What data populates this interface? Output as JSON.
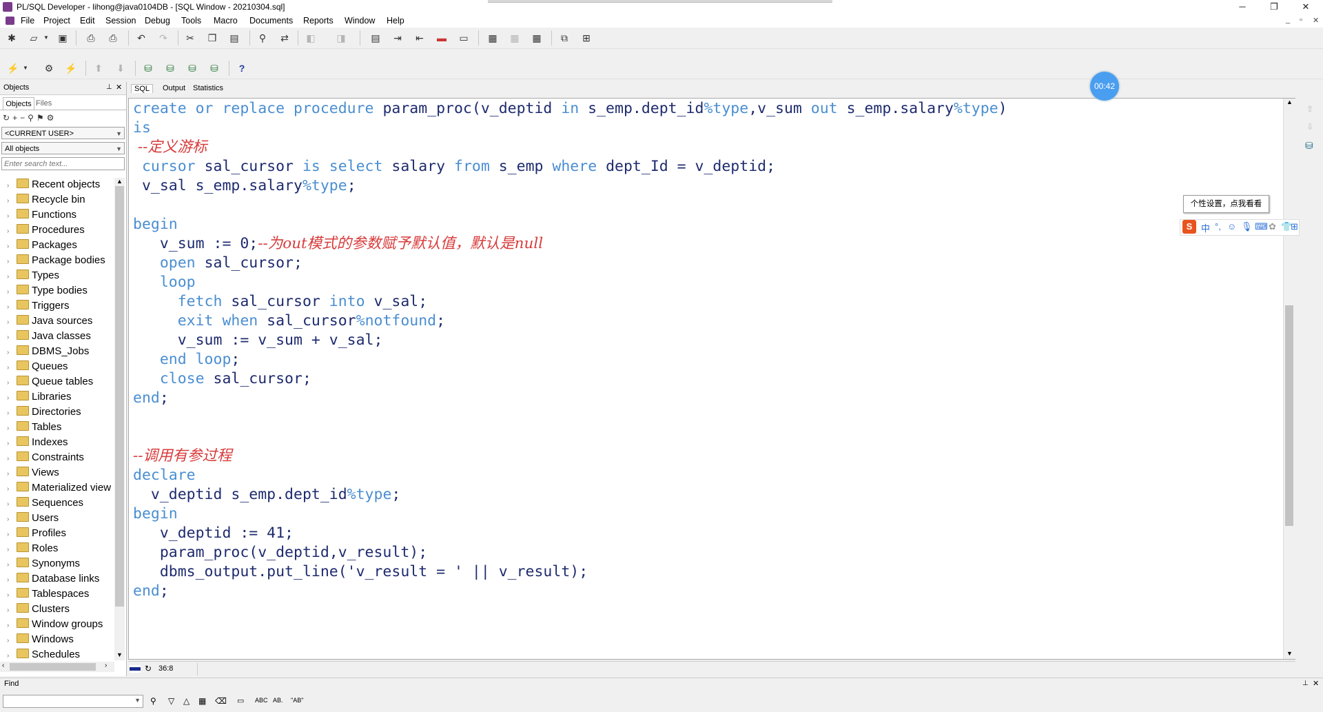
{
  "window": {
    "title": "PL/SQL Developer - lihong@java0104DB - [SQL Window - 20210304.sql]",
    "controls": [
      "─",
      "❐",
      "✕"
    ]
  },
  "menu": [
    "File",
    "Project",
    "Edit",
    "Session",
    "Debug",
    "Tools",
    "Macro",
    "Documents",
    "Reports",
    "Window",
    "Help"
  ],
  "objects_panel": {
    "title": "Objects",
    "tabs": [
      "Objects",
      "Files"
    ],
    "user_combo": "<CURRENT USER>",
    "filter_combo": "All objects",
    "search_placeholder": "Enter search text...",
    "tree": [
      "Recent objects",
      "Recycle bin",
      "Functions",
      "Procedures",
      "Packages",
      "Package bodies",
      "Types",
      "Type bodies",
      "Triggers",
      "Java sources",
      "Java classes",
      "DBMS_Jobs",
      "Queues",
      "Queue tables",
      "Libraries",
      "Directories",
      "Tables",
      "Indexes",
      "Constraints",
      "Views",
      "Materialized view",
      "Sequences",
      "Users",
      "Profiles",
      "Roles",
      "Synonyms",
      "Database links",
      "Tablespaces",
      "Clusters",
      "Window groups",
      "Windows",
      "Schedules"
    ]
  },
  "editor": {
    "tabs": [
      "SQL",
      "Output",
      "Statistics"
    ],
    "active_tab": "SQL",
    "cursor_position": "36:8"
  },
  "find_bar": {
    "label": "Find",
    "input_value": ""
  },
  "overlay": {
    "timer": "00:42",
    "ime_tooltip": "个性设置，点我看看",
    "ime_mode": "中"
  }
}
